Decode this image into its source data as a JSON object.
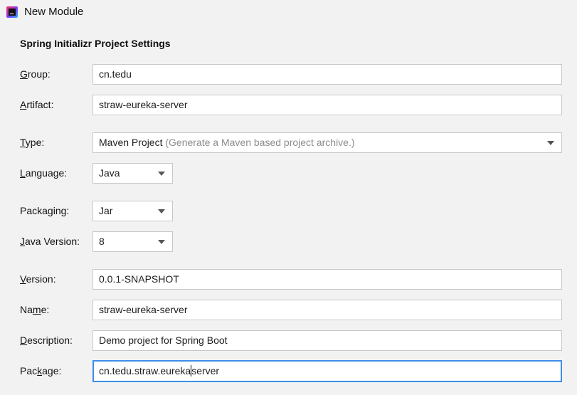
{
  "window": {
    "title": "New Module"
  },
  "section": {
    "title": "Spring Initializr Project Settings"
  },
  "form": {
    "group": {
      "mnemonic": "G",
      "rest": "roup:",
      "value": "cn.tedu"
    },
    "artifact": {
      "mnemonic": "A",
      "rest": "rtifact:",
      "value": "straw-eureka-server"
    },
    "type": {
      "mnemonic": "T",
      "rest": "ype:",
      "value": "Maven Project",
      "hint": "(Generate a Maven based project archive.)"
    },
    "language": {
      "pre": "",
      "mnemonic": "L",
      "rest": "anguage:",
      "value": "Java"
    },
    "packaging": {
      "pre": "Packa",
      "mnemonic": "g",
      "rest": "ing:",
      "value": "Jar"
    },
    "java_version": {
      "pre": "",
      "mnemonic": "J",
      "rest": "ava Version:",
      "value": "8"
    },
    "version": {
      "mnemonic": "V",
      "rest": "ersion:",
      "value": "0.0.1-SNAPSHOT"
    },
    "name": {
      "pre": "Na",
      "mnemonic": "m",
      "rest": "e:",
      "value": "straw-eureka-server"
    },
    "description": {
      "mnemonic": "D",
      "rest": "escription:",
      "value": "Demo project for Spring Boot"
    },
    "package": {
      "pre": "Pac",
      "mnemonic": "k",
      "rest": "age:",
      "value_before_cursor": "cn.tedu.straw.eureka",
      "value_after_cursor": "server"
    }
  }
}
